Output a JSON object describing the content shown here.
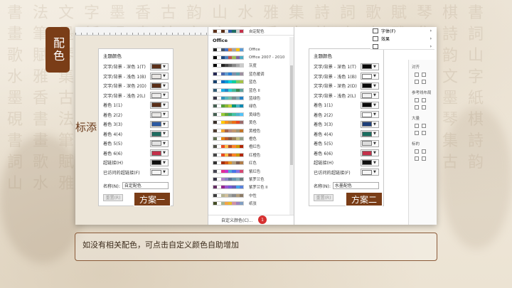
{
  "slide": {
    "title_tag": "配色",
    "partial_slide_title": "标添",
    "caption": "如没有相关配色，可点击自定义颜色自助增加",
    "accent_color": "#7a3d17"
  },
  "scheme1": {
    "label": "方案一",
    "panel_title": "主题颜色",
    "name_label": "名称(N):",
    "name_value": "自定配色",
    "reset_label": "重置(R)",
    "rows": [
      {
        "label": "文字/背景 - 深色 1(T)",
        "color": "#5b2f18"
      },
      {
        "label": "文字/背景 - 浅色 1(B)",
        "color": "#e9e6e3"
      },
      {
        "label": "文字/背景 - 深色 2(D)",
        "color": "#5b2f18"
      },
      {
        "label": "文字/背景 - 浅色 2(L)",
        "color": "#ecebea"
      },
      {
        "label": "着色 1(1)",
        "color": "#5b2f18"
      },
      {
        "label": "着色 2(2)",
        "color": "#e9e8e6"
      },
      {
        "label": "着色 3(3)",
        "color": "#2b5aa4"
      },
      {
        "label": "着色 4(4)",
        "color": "#1f6e63"
      },
      {
        "label": "着色 5(5)",
        "color": "#e3e3e3"
      },
      {
        "label": "着色 6(6)",
        "color": "#c4304a"
      },
      {
        "label": "超链接(H)",
        "color": "#111111"
      },
      {
        "label": "已访问的超链接(F)",
        "color": "#f5f5f5"
      }
    ]
  },
  "scheme2": {
    "label": "方案二",
    "panel_title": "主题颜色",
    "name_label": "名称(N):",
    "name_value": "水墨配色",
    "reset_label": "重置(R)",
    "rows": [
      {
        "label": "文字/背景 - 深色 1(T)",
        "color": "#0a0a0a"
      },
      {
        "label": "文字/背景 - 浅色 1(B)",
        "color": "#ffffff"
      },
      {
        "label": "文字/背景 - 深色 2(D)",
        "color": "#0a0a0a"
      },
      {
        "label": "文字/背景 - 浅色 2(L)",
        "color": "#f2f2f2"
      },
      {
        "label": "着色 1(1)",
        "color": "#0a0a0a"
      },
      {
        "label": "着色 2(2)",
        "color": "#ffffff"
      },
      {
        "label": "着色 3(3)",
        "color": "#1e3f7a"
      },
      {
        "label": "着色 4(4)",
        "color": "#1a6e60"
      },
      {
        "label": "着色 5(5)",
        "color": "#dcdcdc"
      },
      {
        "label": "着色 6(6)",
        "color": "#c4304a"
      },
      {
        "label": "超链接(H)",
        "color": "#111111"
      },
      {
        "label": "已访问的超链接(F)",
        "color": "#f5f5f5"
      }
    ]
  },
  "dropdown": {
    "top_label": "自定配色",
    "section_title": "Office",
    "custom_colors_label": "自定义颜色(C)...",
    "badge": "1",
    "items": [
      {
        "label": "Office",
        "colors": [
          "#222",
          "#fff",
          "#44546a",
          "#4472c4",
          "#ed7d31",
          "#a5a5a5",
          "#ffc000",
          "#5b9bd5"
        ]
      },
      {
        "label": "Office 2007 - 2010",
        "colors": [
          "#000",
          "#fff",
          "#1f497d",
          "#4f81bd",
          "#c0504d",
          "#9bbb59",
          "#8064a2",
          "#4bacc6"
        ]
      },
      {
        "label": "灰度",
        "colors": [
          "#000",
          "#fff",
          "#222",
          "#444",
          "#666",
          "#888",
          "#aaa",
          "#ccc"
        ]
      },
      {
        "label": "蓝色暖调",
        "colors": [
          "#242852",
          "#fff",
          "#4a66ac",
          "#629dd1",
          "#297fd5",
          "#7f8fa9",
          "#5aa2ae",
          "#9d90a0"
        ]
      },
      {
        "label": "蓝色",
        "colors": [
          "#17406d",
          "#fff",
          "#0f6fc6",
          "#009dd9",
          "#0bd0d9",
          "#10cf9b",
          "#7cca62",
          "#a5c249"
        ]
      },
      {
        "label": "蓝色 II",
        "colors": [
          "#335b74",
          "#fff",
          "#1cade4",
          "#2683c6",
          "#27ced7",
          "#42ba97",
          "#3e8853",
          "#62a39f"
        ]
      },
      {
        "label": "蓝绿色",
        "colors": [
          "#373545",
          "#fff",
          "#3494ba",
          "#58b6c0",
          "#75bda7",
          "#7a8c8e",
          "#84acb6",
          "#2683c6"
        ]
      },
      {
        "label": "绿色",
        "colors": [
          "#455f51",
          "#fff",
          "#549e39",
          "#8ab833",
          "#c0cf3a",
          "#029676",
          "#4ab5c4",
          "#0989b1"
        ]
      },
      {
        "label": "黄绿色",
        "colors": [
          "#455f51",
          "#fff",
          "#99cb38",
          "#63a537",
          "#37a76f",
          "#44c1a3",
          "#4eb3cf",
          "#51c3f9"
        ]
      },
      {
        "label": "黄色",
        "colors": [
          "#39302a",
          "#fff",
          "#ffca08",
          "#f8931d",
          "#ce8d3e",
          "#ec7016",
          "#e64823",
          "#9c6a6a"
        ]
      },
      {
        "label": "黄橙色",
        "colors": [
          "#4e3b30",
          "#fff",
          "#f0a22e",
          "#a5644e",
          "#b58b80",
          "#c3986d",
          "#a19574",
          "#c17529"
        ]
      },
      {
        "label": "橙色",
        "colors": [
          "#637052",
          "#fff",
          "#e48312",
          "#bd582c",
          "#865640",
          "#9b8357",
          "#c2bc80",
          "#94a088"
        ]
      },
      {
        "label": "橙红色",
        "colors": [
          "#505046",
          "#fff",
          "#e84c22",
          "#ffbd47",
          "#b64926",
          "#ff8427",
          "#cc9900",
          "#b22600"
        ]
      },
      {
        "label": "红橙色",
        "colors": [
          "#454545",
          "#fff",
          "#e84c22",
          "#ffbd47",
          "#b64926",
          "#ff8427",
          "#cc9900",
          "#b22600"
        ]
      },
      {
        "label": "红色",
        "colors": [
          "#323232",
          "#fff",
          "#a5300f",
          "#d55816",
          "#e19825",
          "#b19c7d",
          "#7f5f52",
          "#b27d49"
        ]
      },
      {
        "label": "紫红色",
        "colors": [
          "#454551",
          "#fff",
          "#e32d91",
          "#c830cc",
          "#4ea6dc",
          "#4775e7",
          "#8971e1",
          "#d54773"
        ]
      },
      {
        "label": "紫罗兰色",
        "colors": [
          "#373545",
          "#fff",
          "#ad84c6",
          "#8784c7",
          "#5d739a",
          "#6997af",
          "#84acb6",
          "#6f8183"
        ]
      },
      {
        "label": "紫罗兰色 II",
        "colors": [
          "#632e62",
          "#fff",
          "#92278f",
          "#9b57d3",
          "#755dd9",
          "#665eb8",
          "#45a5ed",
          "#5982db"
        ]
      },
      {
        "label": "中性",
        "colors": [
          "#3d3d3d",
          "#fff",
          "#b4b392",
          "#d4c09b",
          "#a0a39f",
          "#8b8b8b",
          "#b39f7d",
          "#8c7b66"
        ]
      },
      {
        "label": "纸张",
        "colors": [
          "#444d26",
          "#fff",
          "#a5b592",
          "#f3a447",
          "#e7bc29",
          "#d092a7",
          "#9c85c0",
          "#809ec2"
        ]
      }
    ]
  },
  "right_menu": {
    "items": [
      {
        "label": "字体(F)"
      },
      {
        "label": "效果"
      },
      {
        "label": ""
      }
    ]
  },
  "side_panel": {
    "labels": [
      "对齐",
      "参考线布局",
      "大量",
      "标的"
    ]
  }
}
